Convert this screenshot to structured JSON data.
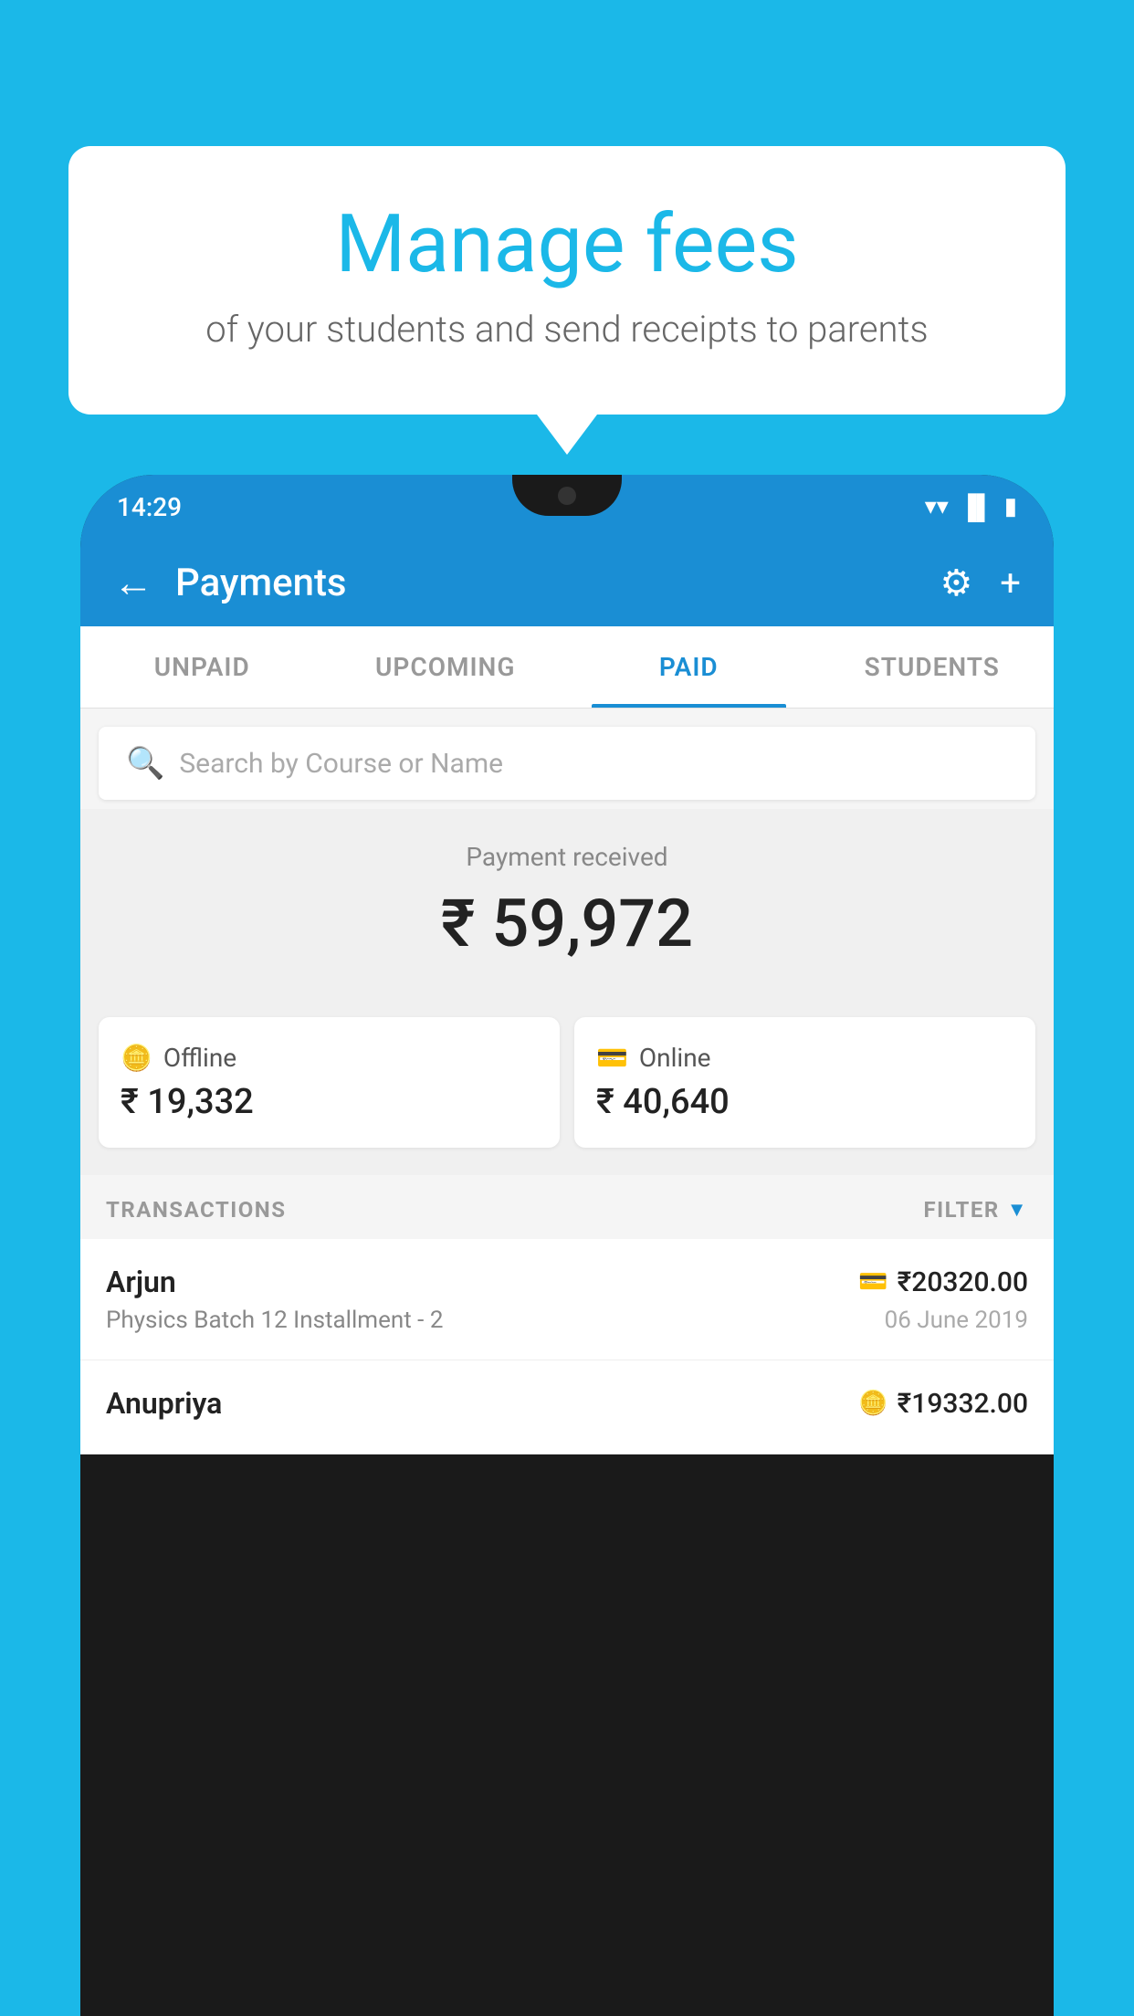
{
  "background_color": "#1bb8e8",
  "bubble": {
    "title": "Manage fees",
    "subtitle": "of your students and send receipts to parents"
  },
  "status_bar": {
    "time": "14:29",
    "icons": [
      "wifi",
      "signal",
      "battery"
    ]
  },
  "header": {
    "title": "Payments",
    "back_label": "←",
    "settings_label": "⚙",
    "add_label": "+"
  },
  "tabs": [
    {
      "label": "UNPAID",
      "active": false
    },
    {
      "label": "UPCOMING",
      "active": false
    },
    {
      "label": "PAID",
      "active": true
    },
    {
      "label": "STUDENTS",
      "active": false
    }
  ],
  "search": {
    "placeholder": "Search by Course or Name"
  },
  "payment_summary": {
    "label": "Payment received",
    "amount": "₹ 59,972",
    "offline": {
      "icon": "card-icon",
      "label": "Offline",
      "amount": "₹ 19,332"
    },
    "online": {
      "icon": "bank-icon",
      "label": "Online",
      "amount": "₹ 40,640"
    }
  },
  "transactions": {
    "label": "TRANSACTIONS",
    "filter_label": "FILTER",
    "items": [
      {
        "name": "Arjun",
        "course": "Physics Batch 12 Installment - 2",
        "amount": "₹20320.00",
        "date": "06 June 2019",
        "payment_type": "online"
      },
      {
        "name": "Anupriya",
        "course": "",
        "amount": "₹19332.00",
        "date": "",
        "payment_type": "offline"
      }
    ]
  }
}
